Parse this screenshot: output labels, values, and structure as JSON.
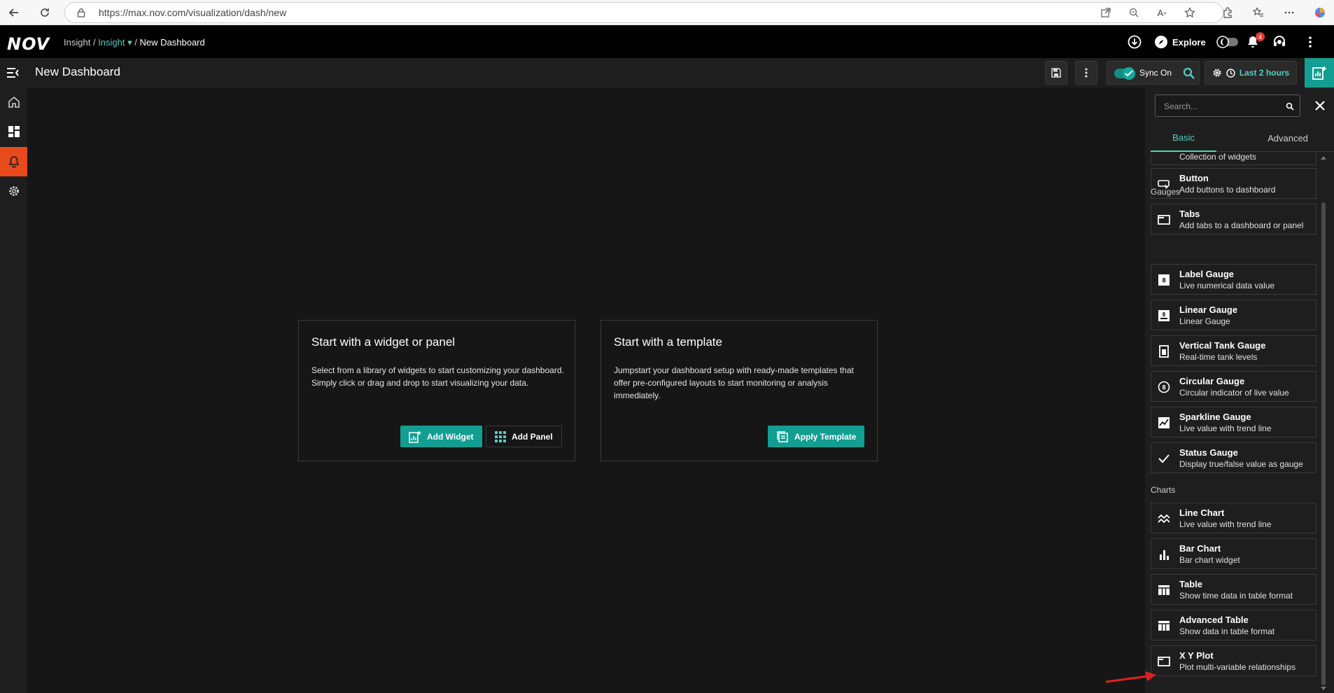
{
  "browser": {
    "url": "https://max.nov.com/visualization/dash/new"
  },
  "app": {
    "logo": "NOV",
    "breadcrumb": {
      "root": "Insight",
      "sep1": "/",
      "module": "Insight",
      "sep2": "/",
      "current": "New Dashboard"
    },
    "explore_label": "Explore",
    "notification_count": "4"
  },
  "dashboard": {
    "title": "New Dashboard",
    "sync_label": "Sync On",
    "time_range": "Last 2 hours"
  },
  "cards": {
    "widget": {
      "title": "Start with a widget or panel",
      "description": "Select from a library of widgets to start customizing your dashboard. Simply click or drag and drop to start visualizing your data.",
      "add_widget": "Add Widget",
      "add_panel": "Add Panel"
    },
    "template": {
      "title": "Start with a template",
      "description": "Jumpstart your dashboard setup with ready-made templates that offer pre-configured layouts to start monitoring or analysis immediately.",
      "apply": "Apply Template"
    }
  },
  "panel": {
    "search_placeholder": "Search...",
    "tabs": [
      "Basic",
      "Advanced"
    ],
    "partial_item": "Collection of widgets",
    "layout_items": [
      {
        "name": "Button",
        "desc": "Add buttons to dashboard",
        "icon": "button-icon"
      },
      {
        "name": "Tabs",
        "desc": "Add tabs to a dashboard or panel",
        "icon": "tabs-icon"
      }
    ],
    "gauges_title": "Gauges",
    "gauges": [
      {
        "name": "Label Gauge",
        "desc": "Live numerical data value",
        "icon": "label-gauge-icon"
      },
      {
        "name": "Linear Gauge",
        "desc": "Linear Gauge",
        "icon": "linear-gauge-icon"
      },
      {
        "name": "Vertical Tank Gauge",
        "desc": "Real-time tank levels",
        "icon": "tank-gauge-icon"
      },
      {
        "name": "Circular Gauge",
        "desc": "Circular indicator of live value",
        "icon": "circular-gauge-icon"
      },
      {
        "name": "Sparkline Gauge",
        "desc": "Live value with trend line",
        "icon": "sparkline-icon"
      },
      {
        "name": "Status Gauge",
        "desc": "Display true/false value as gauge",
        "icon": "check-icon"
      }
    ],
    "charts_title": "Charts",
    "charts": [
      {
        "name": "Line Chart",
        "desc": "Live value with trend line",
        "icon": "line-chart-icon"
      },
      {
        "name": "Bar Chart",
        "desc": "Bar chart widget",
        "icon": "bar-chart-icon"
      },
      {
        "name": "Table",
        "desc": "Show time data in table format",
        "icon": "table-icon"
      },
      {
        "name": "Advanced Table",
        "desc": "Show data in table format",
        "icon": "advanced-table-icon"
      },
      {
        "name": "X Y Plot",
        "desc": "Plot multi-variable relationships",
        "icon": "xy-plot-icon"
      }
    ]
  },
  "colors": {
    "accent": "#139e92",
    "accent_text": "#4fd1c5",
    "alert_nav": "#e8491d",
    "annotation_arrow": "#e02020"
  }
}
